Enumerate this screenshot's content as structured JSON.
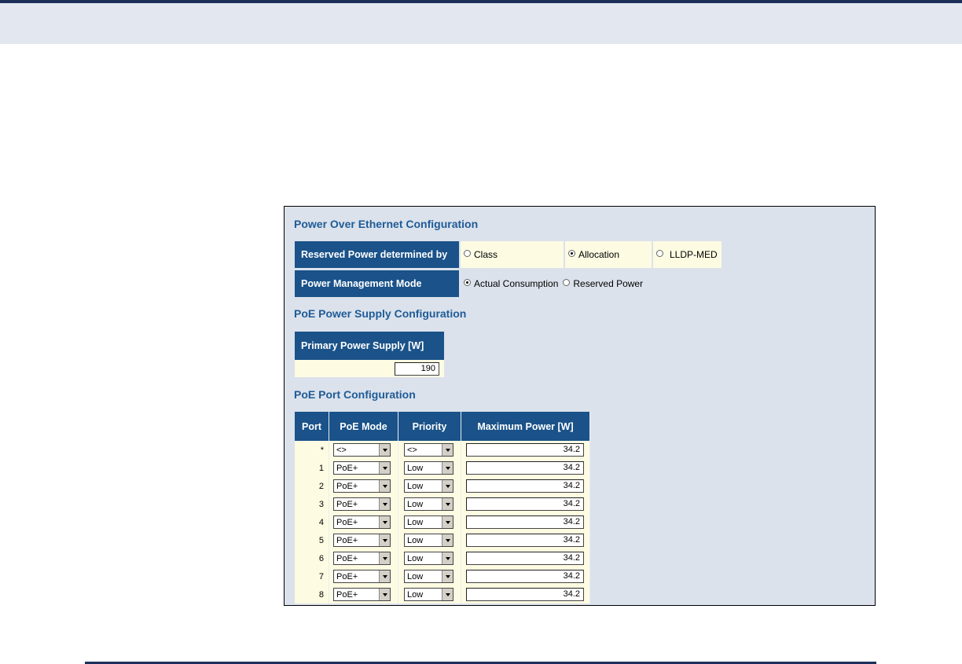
{
  "title": "Power Over Ethernet Configuration",
  "reserved_power": {
    "label": "Reserved Power determined by",
    "options": [
      {
        "label": "Class",
        "selected": false
      },
      {
        "label": "Allocation",
        "selected": true
      },
      {
        "label": "LLDP-MED",
        "selected": false
      }
    ]
  },
  "power_mgmt": {
    "label": "Power Management Mode",
    "options": [
      {
        "label": "Actual Consumption",
        "selected": true
      },
      {
        "label": "Reserved Power",
        "selected": false
      }
    ]
  },
  "supply": {
    "title": "PoE Power Supply Configuration",
    "header": "Primary Power Supply [W]",
    "value": "190"
  },
  "port_config": {
    "title": "PoE Port Configuration",
    "columns": [
      "Port",
      "PoE Mode",
      "Priority",
      "Maximum Power [W]"
    ],
    "rows": [
      {
        "port": "*",
        "mode": "<>",
        "priority": "<>",
        "max_power": "34.2"
      },
      {
        "port": "1",
        "mode": "PoE+",
        "priority": "Low",
        "max_power": "34.2"
      },
      {
        "port": "2",
        "mode": "PoE+",
        "priority": "Low",
        "max_power": "34.2"
      },
      {
        "port": "3",
        "mode": "PoE+",
        "priority": "Low",
        "max_power": "34.2"
      },
      {
        "port": "4",
        "mode": "PoE+",
        "priority": "Low",
        "max_power": "34.2"
      },
      {
        "port": "5",
        "mode": "PoE+",
        "priority": "Low",
        "max_power": "34.2"
      },
      {
        "port": "6",
        "mode": "PoE+",
        "priority": "Low",
        "max_power": "34.2"
      },
      {
        "port": "7",
        "mode": "PoE+",
        "priority": "Low",
        "max_power": "34.2"
      },
      {
        "port": "8",
        "mode": "PoE+",
        "priority": "Low",
        "max_power": "34.2"
      }
    ]
  },
  "colors": {
    "header_bg": "#1a5289",
    "title_text": "#1f5b96",
    "panel_bg": "#dbe2ec",
    "cell_bg": "#fdfbe2",
    "rule": "#1b2f5a"
  }
}
